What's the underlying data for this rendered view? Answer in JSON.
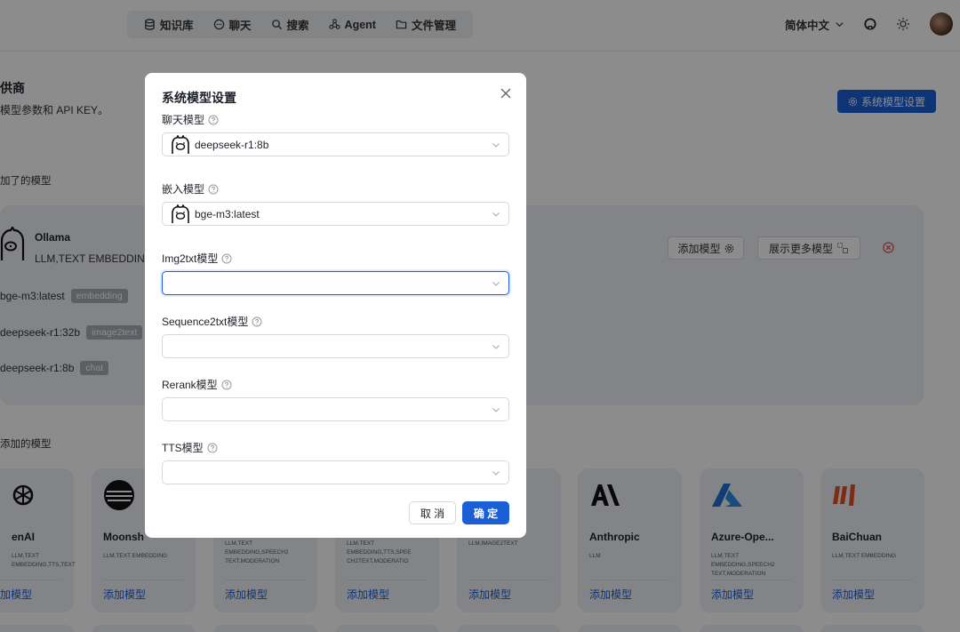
{
  "topnav": {
    "items": [
      {
        "label": "知识库",
        "icon": "database-icon"
      },
      {
        "label": "聊天",
        "icon": "chat-icon"
      },
      {
        "label": "搜索",
        "icon": "search-icon"
      },
      {
        "label": "Agent",
        "icon": "agent-icon"
      },
      {
        "label": "文件管理",
        "icon": "folder-icon"
      }
    ],
    "language": "简体中文",
    "icons": [
      "github-icon",
      "sun-icon"
    ]
  },
  "page": {
    "title": "供商",
    "subtitle": "模型参数和 API KEY。",
    "system_model_button": "系统模型设置",
    "added_section_label": "加了的模型",
    "to_add_section_label": "添加的模型"
  },
  "added_provider": {
    "name": "Ollama",
    "tags": "LLM,TEXT EMBEDDING",
    "add_model_button": "添加模型",
    "show_more_button": "展示更多模型",
    "models": [
      {
        "name": "bge-m3:latest",
        "tag": "embedding"
      },
      {
        "name": "deepseek-r1:32b",
        "tag": "image2text"
      },
      {
        "name": "deepseek-r1:8b",
        "tag": "chat"
      }
    ]
  },
  "providers": [
    {
      "name": "enAI",
      "tags": "LLM,TEXT EMBEDDING,TTS,TEXT",
      "add": "加模型"
    },
    {
      "name": "Moonsh",
      "tags": "LLM,TEXT EMBEDDING",
      "add": "添加模型"
    },
    {
      "name": "",
      "tags": "LLM,TEXT EMBEDDING,SPEECH2 TEXT,MODERATION",
      "add": "添加模型"
    },
    {
      "name": "",
      "tags": "LLM,TEXT EMBEDDING,TTS,SPEE CH2TEXT,MODERATIO",
      "add": "添加模型"
    },
    {
      "name": "",
      "tags": "LLM,IMAGE2TEXT",
      "add": "添加模型"
    },
    {
      "name": "Anthropic",
      "tags": "LLM",
      "add": "添加模型"
    },
    {
      "name": "Azure-Ope...",
      "tags": "LLM,TEXT EMBEDDING,SPEECH2 TEXT,MODERATION",
      "add": "添加模型"
    },
    {
      "name": "BaiChuan",
      "tags": "LLM,TEXT EMBEDDING",
      "add": "添加模型"
    }
  ],
  "modal": {
    "title": "系统模型设置",
    "fields": [
      {
        "label": "聊天模型",
        "value": "deepseek-r1:8b",
        "has_logo": true
      },
      {
        "label": "嵌入模型",
        "value": "bge-m3:latest",
        "has_logo": true
      },
      {
        "label": "Img2txt模型",
        "value": "",
        "focused": true
      },
      {
        "label": "Sequence2txt模型",
        "value": ""
      },
      {
        "label": "Rerank模型",
        "value": ""
      },
      {
        "label": "TTS模型",
        "value": ""
      }
    ],
    "cancel_label": "取 消",
    "ok_label": "确 定"
  },
  "colors": {
    "accent": "#1a5fd6",
    "card_bg": "#eef1f7",
    "danger": "#e5484d"
  }
}
